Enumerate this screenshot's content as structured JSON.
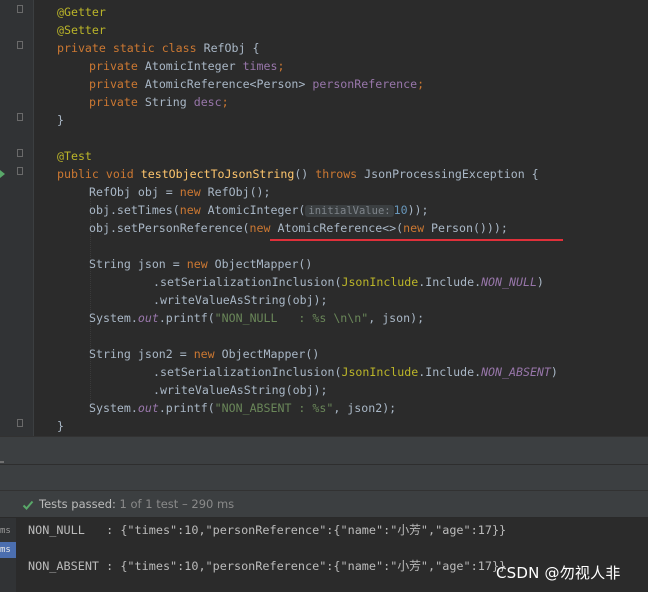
{
  "code": {
    "l1_ann": "@Getter",
    "l2_ann": "@Setter",
    "l3": {
      "kw": "private static class",
      "name": " RefObj {"
    },
    "l4": {
      "kw": "private",
      "type": " AtomicInteger ",
      "field": "times",
      "end": ";"
    },
    "l5": {
      "kw": "private",
      "type": " AtomicReference<Person> ",
      "field": "personReference",
      "end": ";"
    },
    "l6": {
      "kw": "private",
      "type": " String ",
      "field": "desc",
      "end": ";"
    },
    "l7": "}",
    "l9_ann": "@Test",
    "l10": {
      "kw1": "public void ",
      "method": "testObjectToJsonString",
      "mid": "() ",
      "kw2": "throws",
      "end": " JsonProcessingException {"
    },
    "l11": {
      "a": "RefObj obj = ",
      "kw": "new",
      "b": " RefObj();"
    },
    "l12": {
      "a": "obj.setTimes(",
      "kw": "new",
      "b": " AtomicInteger(",
      "hint": "initialValue:",
      "num": "10",
      "c": "));"
    },
    "l13": {
      "a": "obj.setPersonReference(",
      "kw1": "new",
      "b": " AtomicReference<>(",
      "kw2": "new",
      "c": " Person()));"
    },
    "l15": {
      "a": "String json = ",
      "kw": "new",
      "b": " ObjectMapper()"
    },
    "l16": {
      "a": ".setSerializationInclusion(",
      "cls": "JsonInclude",
      "b": ".Include.",
      "cst": "NON_NULL",
      "c": ")"
    },
    "l17": ".writeValueAsString(obj);",
    "l18": {
      "a": "System.",
      "out": "out",
      "b": ".printf(",
      "str": "\"NON_NULL   : %s \\n\\n\"",
      "c": ", json);"
    },
    "l20": {
      "a": "String json2 = ",
      "kw": "new",
      "b": " ObjectMapper()"
    },
    "l21": {
      "a": ".setSerializationInclusion(",
      "cls": "JsonInclude",
      "b": ".Include.",
      "cst": "NON_ABSENT",
      "c": ")"
    },
    "l22": ".writeValueAsString(obj);",
    "l23": {
      "a": "System.",
      "out": "out",
      "b": ".printf(",
      "str": "\"NON_ABSENT : %s\"",
      "c": ", json2);"
    },
    "l24": "}"
  },
  "status": {
    "label": "Tests passed:",
    "count": "1",
    "rest": "of 1 test – 290 ms"
  },
  "console": {
    "ms1": "ms",
    "ms2": "ms",
    "line1": "NON_NULL   : {\"times\":10,\"personReference\":{\"name\":\"小芳\",\"age\":17}}",
    "line2": "NON_ABSENT : {\"times\":10,\"personReference\":{\"name\":\"小芳\",\"age\":17}}"
  },
  "watermark": "CSDN @勿视人非",
  "colors": {
    "background": "#2b2b2b",
    "keyword": "#cc7832",
    "annotation": "#bbb529",
    "field": "#9876aa",
    "method": "#ffc66d",
    "string": "#6a8759",
    "number": "#6897bb",
    "error_underline": "#e0303a",
    "pass": "#59a869"
  }
}
